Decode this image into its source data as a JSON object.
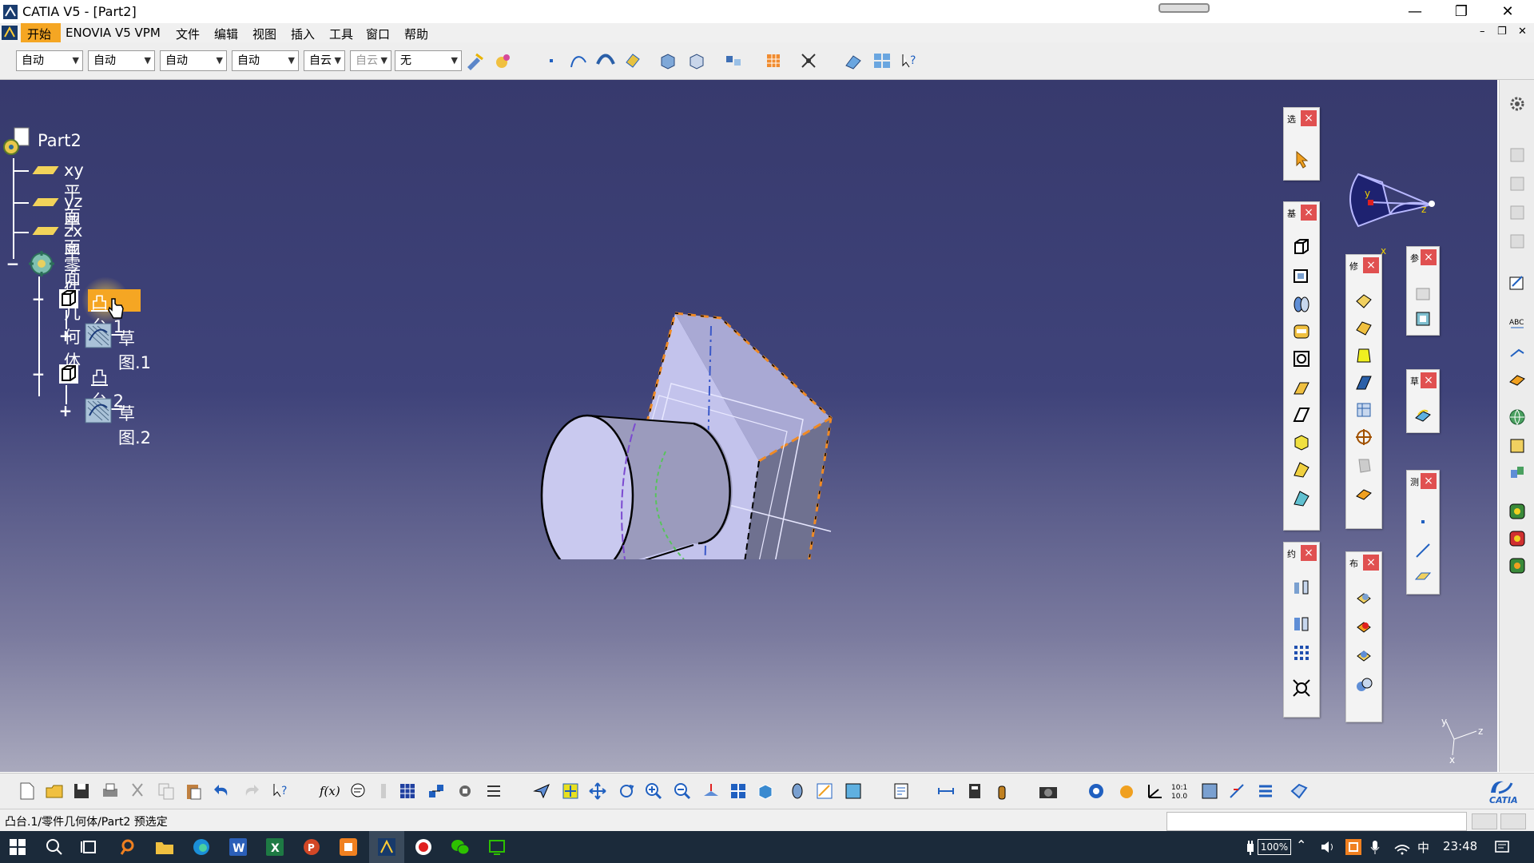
{
  "window": {
    "title": "CATIA V5 - [Part2]",
    "controls": {
      "minimize": "—",
      "restore": "❐",
      "close": "✕"
    },
    "inner_controls": {
      "minimize": "–",
      "restore": "❐",
      "close": "✕"
    }
  },
  "menu": {
    "items": [
      "开始",
      "ENOVIA V5 VPM",
      "文件",
      "编辑",
      "视图",
      "插入",
      "工具",
      "窗口",
      "帮助"
    ]
  },
  "toolbar": {
    "combos": [
      "自动",
      "自动",
      "自动",
      "自动",
      "自云",
      "自云",
      "无"
    ]
  },
  "tree": {
    "root": "Part2",
    "nodes": {
      "xy_plane": "xy 平面",
      "yz_plane": "yz 平面",
      "zx_plane": "zx 平面",
      "body": "零件几何体",
      "pad1": "凸台.1",
      "sketch1": "草图.1",
      "pad2": "凸台.2",
      "sketch2": "草图.2"
    },
    "expanders": {
      "minus": "−",
      "plus": "+"
    }
  },
  "panels": {
    "titles": [
      "选",
      "基",
      "约",
      "修",
      "布",
      "参",
      "草",
      "测"
    ],
    "close": "×"
  },
  "axis": {
    "x": "x",
    "y": "y",
    "z": "z"
  },
  "brand": "CATIA",
  "status": {
    "text": "凸台.1/零件几何体/Part2 预选定"
  },
  "taskbar": {
    "battery": "100%",
    "ime": "中",
    "time": "23:48"
  },
  "colors": {
    "viewport_top": "#373a6d",
    "viewport_bottom": "#a9a9bd",
    "selection": "#f5a623",
    "taskbar": "#1b2a3a"
  }
}
